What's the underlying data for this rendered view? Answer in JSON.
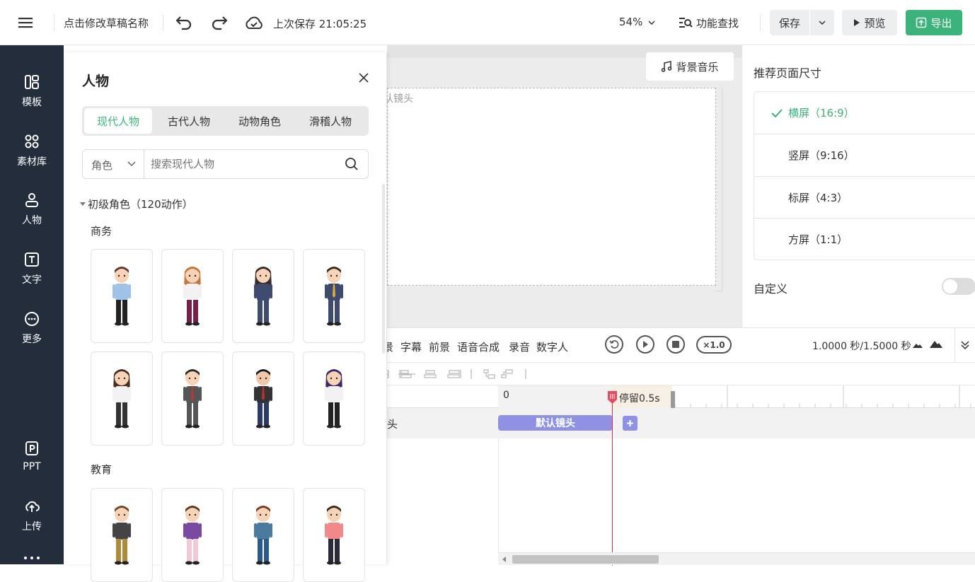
{
  "header": {
    "draft_name": "点击修改草稿名称",
    "last_saved": "上次保存 21:05:25",
    "zoom": "54%",
    "feature_search": "功能查找",
    "save": "保存",
    "preview": "预览",
    "export": "导出"
  },
  "sidebar": {
    "items": [
      {
        "label": "模板",
        "icon": "template-icon"
      },
      {
        "label": "素材库",
        "icon": "library-icon"
      },
      {
        "label": "人物",
        "icon": "person-icon"
      },
      {
        "label": "文字",
        "icon": "text-icon"
      },
      {
        "label": "更多",
        "icon": "more-icon"
      },
      {
        "label": "PPT",
        "icon": "ppt-icon"
      },
      {
        "label": "上传",
        "icon": "upload-icon"
      }
    ]
  },
  "panel": {
    "title": "人物",
    "tabs": [
      "现代人物",
      "古代人物",
      "动物角色",
      "滑稽人物"
    ],
    "active_tab": 0,
    "filter": "角色",
    "search_placeholder": "搜索现代人物",
    "group": "初级角色（120动作）",
    "sections": [
      {
        "name": "商务"
      },
      {
        "name": "教育"
      }
    ]
  },
  "canvas": {
    "bg_music": "背景音乐",
    "shot_label": "认镜头"
  },
  "right_panel": {
    "title": "推荐页面尺寸",
    "options": [
      "横屏（16:9）",
      "竖屏（9:16）",
      "标屏（4:3）",
      "方屏（1:1）"
    ],
    "selected": 0,
    "custom": "自定义",
    "accent": "#3cb37a"
  },
  "timeline": {
    "tabs": [
      "景",
      "字幕",
      "前景",
      "语音合成",
      "录音",
      "数字人"
    ],
    "speed": "×1.0",
    "time": "1.0000 秒/1.5000 秒",
    "ruler_start": "0",
    "pause_label": "停留0.5s",
    "track_label": "头",
    "clip_label": "默认镜头"
  }
}
